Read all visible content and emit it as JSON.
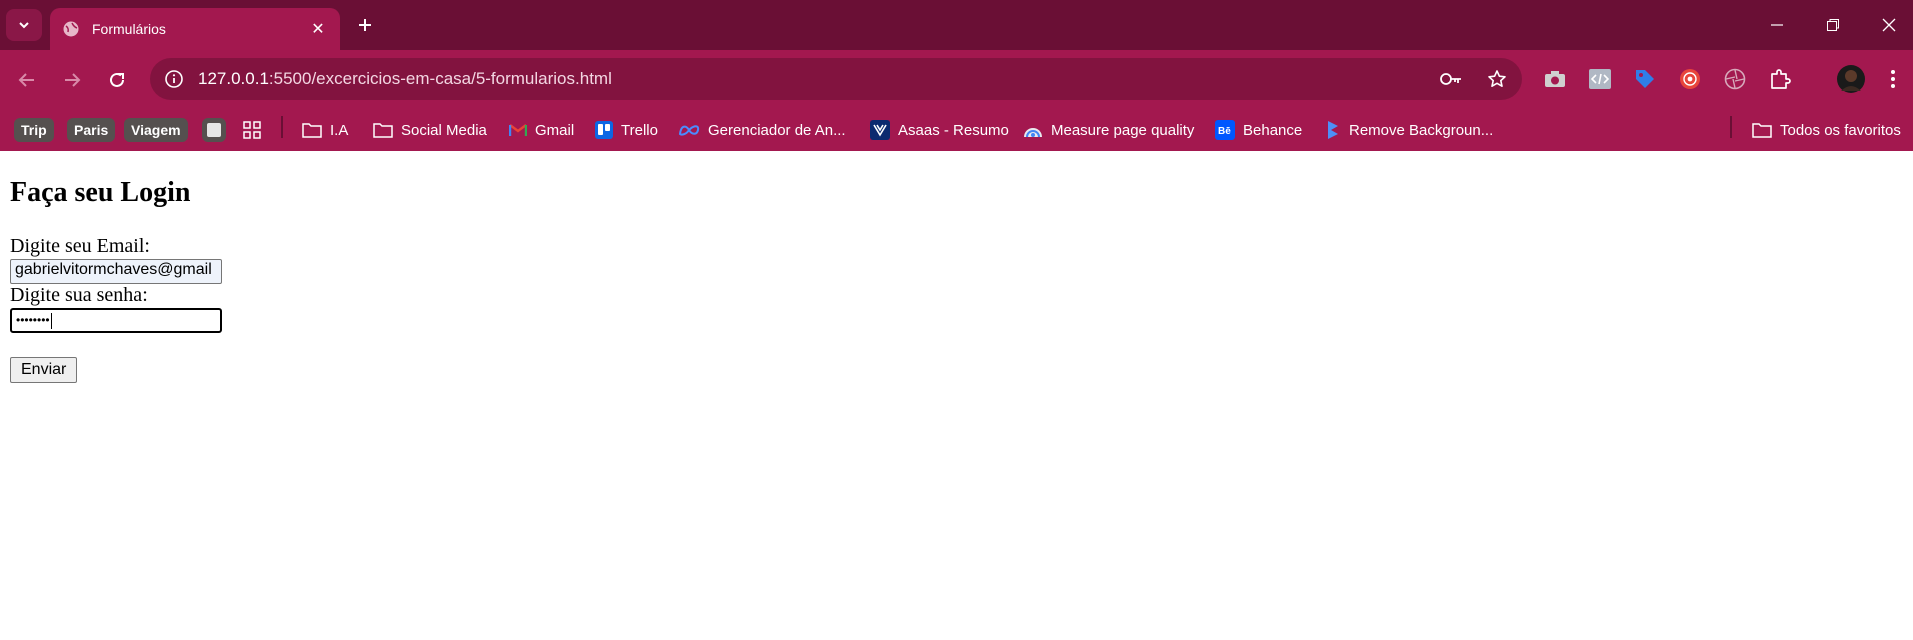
{
  "browser": {
    "tab": {
      "title": "Formulários"
    },
    "address": {
      "host": "127.0.0.1",
      "path": ":5500/excercicios-em-casa/5-formularios.html"
    },
    "bookmarks": {
      "chips": [
        "Trip",
        "Paris",
        "Viagem"
      ],
      "items": [
        {
          "label": "I.A",
          "icon": "folder-icon"
        },
        {
          "label": "Social Media",
          "icon": "folder-icon"
        },
        {
          "label": "Gmail",
          "icon": "gmail-icon"
        },
        {
          "label": "Trello",
          "icon": "trello-icon"
        },
        {
          "label": "Gerenciador de An...",
          "icon": "meta-icon"
        },
        {
          "label": "Asaas - Resumo",
          "icon": "asaas-icon"
        },
        {
          "label": "Measure page quality",
          "icon": "lighthouse-icon"
        },
        {
          "label": "Behance",
          "icon": "behance-icon"
        },
        {
          "label": "Remove Backgroun...",
          "icon": "removebg-icon"
        }
      ],
      "all_label": "Todos os favoritos"
    },
    "colors": {
      "tabstrip": "#6a0f35",
      "toolbar": "#a3184f",
      "omnibox": "#82133f"
    }
  },
  "page": {
    "heading": "Faça seu Login",
    "email_label": "Digite seu Email:",
    "email_value": "gabrielvitormchaves@gmail",
    "password_label": "Digite sua senha:",
    "password_mask": "••••••••",
    "submit_label": "Enviar"
  }
}
